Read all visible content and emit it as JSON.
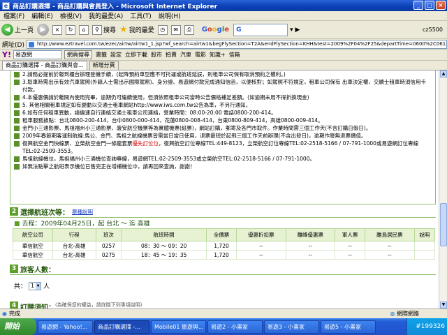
{
  "window": {
    "title": "商品訂購選擇 - 商品訂購與會員登入 - Microsoft Internet Explorer"
  },
  "menubar": [
    "檔案(F)",
    "編輯(E)",
    "檢視(V)",
    "我的最愛(A)",
    "工具(T)",
    "說明(H)"
  ],
  "toolbar": {
    "back": "上一頁",
    "search": "搜尋",
    "favorites": "我的最愛",
    "google_label": "Google",
    "google_input": "G",
    "right_status": "cz5500"
  },
  "address": {
    "label": "網址(D)",
    "url": "http://www.eztravel.com.tw/ezec/airtw/airtw1_1.jsp?wf_search=airtw1&begFlySection=T2A&endFlySection=KHH&test=2009%2F04%2F25&departTime=0600%2C0612%2C0934&flyDe"
  },
  "yahoo": {
    "logo": "Y!",
    "search_value": "易遊網",
    "search_button": "網頁搜尋",
    "items": [
      "書籤",
      "設定",
      "立即下載",
      "股市",
      "拍賣",
      "汽車",
      "電影",
      "知識+",
      "信箱"
    ]
  },
  "tabs": {
    "active": "商品訂購選擇 - 商品訂購與會...",
    "new": "新增分頁"
  },
  "notices": [
    {
      "text": "2.請務必提前於報到櫃台辦理登機手續，(起降預約車型應不可托運或航班延誤，則租車公司保有取消預約之權利。)",
      "red": ""
    },
    {
      "text": "3.取車時需出示有效汽車駕照(外籍人士需出示國際駕照)、身分證、易遊網付款完成通知信函，以便核對；如駕照不符規定，租車公司保有 出車決定權，交續士租車時須信用卡付款。",
      "red": ""
    },
    {
      "text": "4.本優惠價請於離開內使用完畢，逾期仍可繼續使用，但須依照租車公司當時公告價格補足差額。(如逾期未用不得折換現金)",
      "red": ""
    },
    {
      "text": "5. 其他相關租車規定如有變動以交通士租車網站http://www.iws.com.tw公告為準，不另行通知。",
      "red": ""
    },
    {
      "text": "6.如有任何租車異動，請儘速自行連絡交通士租車公司連絡，營業時間：08:00-20:00 電話0800-200-414。",
      "red": ""
    },
    {
      "text": "租車服務據點：台北0800-200-414，台中0800-000-414，花蓮0800-008-414，台東0800-809-414，高雄0800-009-414。",
      "red": ""
    },
    {
      "text": "金門小三通影票、馬祖福州小三通影票、廈安航空機票等為實體機票(紙票)，網站訂購，郵寄及各門市取件。作業時間需三個工作天(不含訂購日假日)。",
      "red": ""
    },
    {
      "text": "2009年春節期客運制航線:馬公、金門、馬祖之航線機票皆需當日當日使用，退票最短於起飛三個工作天前辦理(不含出發日)，逾期作廢無退票價值。",
      "red": ""
    },
    {
      "text": "復興航空金門快線票、立榮航空金門一條龍套票",
      "red": "優先訂位位",
      "after": "，復興航空訂位專線TEL:449-8123，立榮航空訂位專線TEL:02-2518-5166 / 07-791-1000或易遊網訂位專線TEL:02-2509-3553。"
    },
    {
      "text": "馬祖航線機位，馬祖福州小三通機位查詢專線，易遊網TEL:02-2509-3553或立榮航空TEL:02-2518-5166 / 07-791-1000。",
      "red": ""
    },
    {
      "text": "如無法點擊之航班表示機位已售完正在增補機位中，請再回來查詢，謝謝！",
      "red": ""
    }
  ],
  "section2": {
    "num": "2",
    "title": "選擇航班次等：",
    "link": "票種說明",
    "route": "去程：2009年04月25日，起 台北 ～ 迄 高雄"
  },
  "table": {
    "headers": [
      "航空公司",
      "行程",
      "班次",
      "航班時間",
      "全價票",
      "優惠折扣票",
      "離峰優惠票",
      "軍人票",
      "離島居民票",
      "說明"
    ],
    "rows": [
      [
        "華信航空",
        "台北-高雄",
        "0257",
        "08：30 ～ 09：20",
        "1,720",
        "--",
        "--",
        "--",
        "--",
        ""
      ],
      [
        "華信航空",
        "台北-高雄",
        "0275",
        "18：45 ～ 19：35",
        "1,720",
        "--",
        "--",
        "--",
        "--",
        ""
      ]
    ]
  },
  "section3": {
    "num": "3",
    "title": "旅客人數：",
    "count_label": "共：",
    "count_value": "1",
    "count_unit": "人"
  },
  "section4": {
    "num": "4",
    "title": "訂購須知：",
    "note": "(為確保您的權益，請詳閱下列事項說明)"
  },
  "status": {
    "text": "完成",
    "zone": "網際網路"
  },
  "taskbar": {
    "start": "開始",
    "tasks": [
      "易遊網 - Yahoo!...",
      "商品訂購選擇 -...",
      "Mobile01 旅遊與...",
      "易遊2 - 小畫家",
      "易遊3 - 小畫家",
      "易遊5 - 小畫家"
    ],
    "active_index": 1,
    "tray": "#199326"
  }
}
